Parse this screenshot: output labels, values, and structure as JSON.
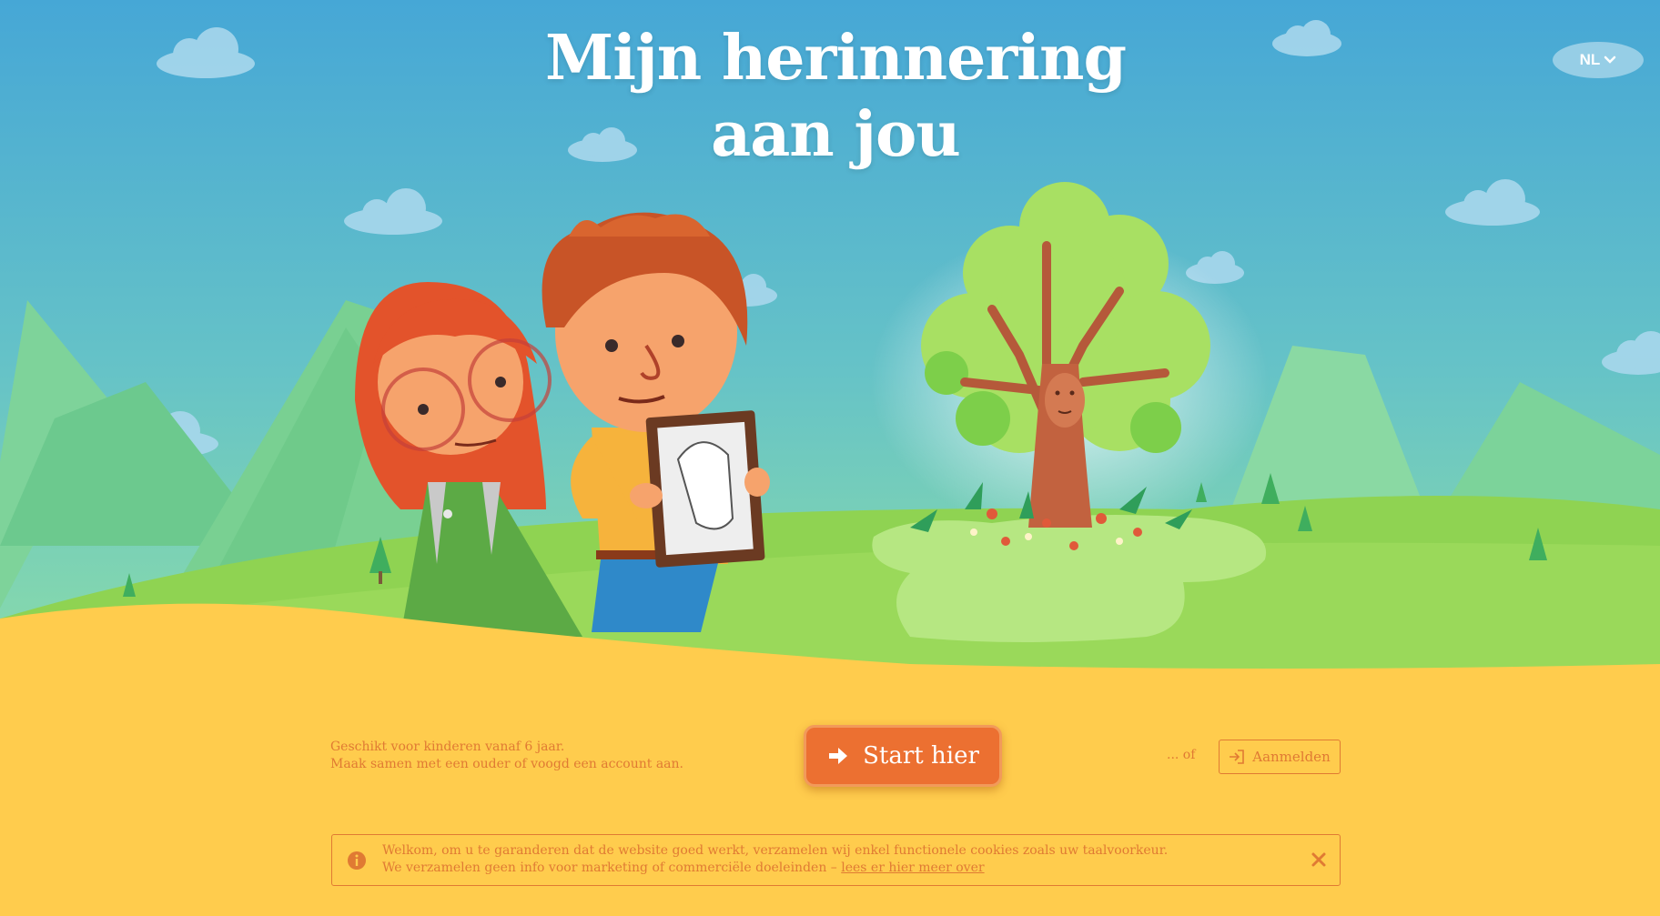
{
  "header": {
    "title_line1": "Mijn herinnering",
    "title_line2": "aan jou",
    "language": "NL"
  },
  "actions": {
    "info_line1": "Geschikt voor kinderen vanaf 6 jaar.",
    "info_line2": "Maak samen met een ouder of voogd een account aan.",
    "start_label": "Start hier",
    "or_label": "... of",
    "login_label": "Aanmelden"
  },
  "cookie_notice": {
    "line1": "Welkom, om u te garanderen dat de website goed werkt, verzamelen wij enkel functionele cookies zoals uw taalvoorkeur.",
    "line2_prefix": "We verzamelen geen info voor marketing of commerciële doeleinden – ",
    "link_label": "lees er hier meer over"
  },
  "icons": {
    "language_chevron": "chevron-down-icon",
    "start": "arrow-right-icon",
    "login": "sign-in-icon",
    "info": "info-icon",
    "close": "close-icon"
  },
  "colors": {
    "accent": "#ec7031",
    "text_orange": "#e07a33",
    "sand": "#ffcc4d",
    "sky_top": "#46a7d6",
    "grass": "#8fd352"
  }
}
